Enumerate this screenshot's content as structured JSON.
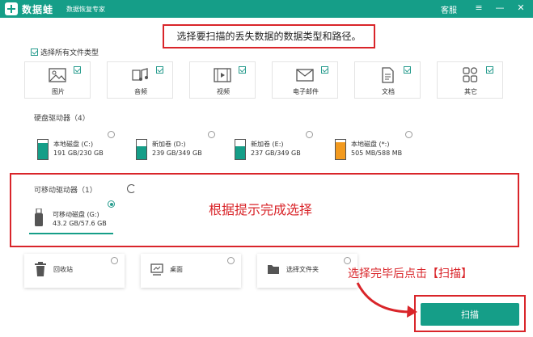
{
  "app": {
    "name": "数据蛙",
    "subtitle": "数据恢复专家",
    "service_label": "客服",
    "menu_icon": "hamburger-menu-icon",
    "minimize_icon": "minimize-icon",
    "close_icon": "close-icon"
  },
  "banner_text": "选择要扫描的丢失数据的数据类型和路径。",
  "file_types": {
    "select_all_label": "选择所有文件类型",
    "select_all_checked": true,
    "items": [
      {
        "label": "图片",
        "icon": "image-icon",
        "checked": true
      },
      {
        "label": "音频",
        "icon": "music-note-icon",
        "checked": true
      },
      {
        "label": "视频",
        "icon": "film-icon",
        "checked": true
      },
      {
        "label": "电子邮件",
        "icon": "envelope-icon",
        "checked": true
      },
      {
        "label": "文档",
        "icon": "document-icon",
        "checked": true
      },
      {
        "label": "其它",
        "icon": "grid-icon",
        "checked": true
      }
    ]
  },
  "hard_drives": {
    "title": "硬盘驱动器（4）",
    "items": [
      {
        "name": "本地磁盘 (C:)",
        "size": "191 GB/230 GB",
        "color": "#159e88",
        "fill": 0.83,
        "selected": false
      },
      {
        "name": "新加卷 (D:)",
        "size": "239 GB/349 GB",
        "color": "#159e88",
        "fill": 0.68,
        "selected": false
      },
      {
        "name": "新加卷 (E:)",
        "size": "237 GB/349 GB",
        "color": "#159e88",
        "fill": 0.68,
        "selected": false
      },
      {
        "name": "本地磁盘 (*:)",
        "size": "505 MB/588 MB",
        "color": "#f39a1e",
        "fill": 0.86,
        "selected": false
      }
    ]
  },
  "removable": {
    "title": "可移动驱动器（1）",
    "refresh_icon": "refresh-icon",
    "items": [
      {
        "name": "可移动磁盘 (G:)",
        "size": "43.2 GB/57.6 GB",
        "icon": "usb-drive-icon",
        "selected": true
      }
    ]
  },
  "hint_select": "根据提示完成选择",
  "locations": [
    {
      "label": "回收站",
      "icon": "trash-icon"
    },
    {
      "label": "桌面",
      "icon": "desktop-icon"
    },
    {
      "label": "选择文件夹",
      "icon": "folder-icon"
    }
  ],
  "hint_scan": "选择完毕后点击【扫描】",
  "scan_label": "扫描",
  "colors": {
    "brand": "#159e88",
    "annotation": "#d9252a",
    "warning_drive": "#f39a1e"
  }
}
